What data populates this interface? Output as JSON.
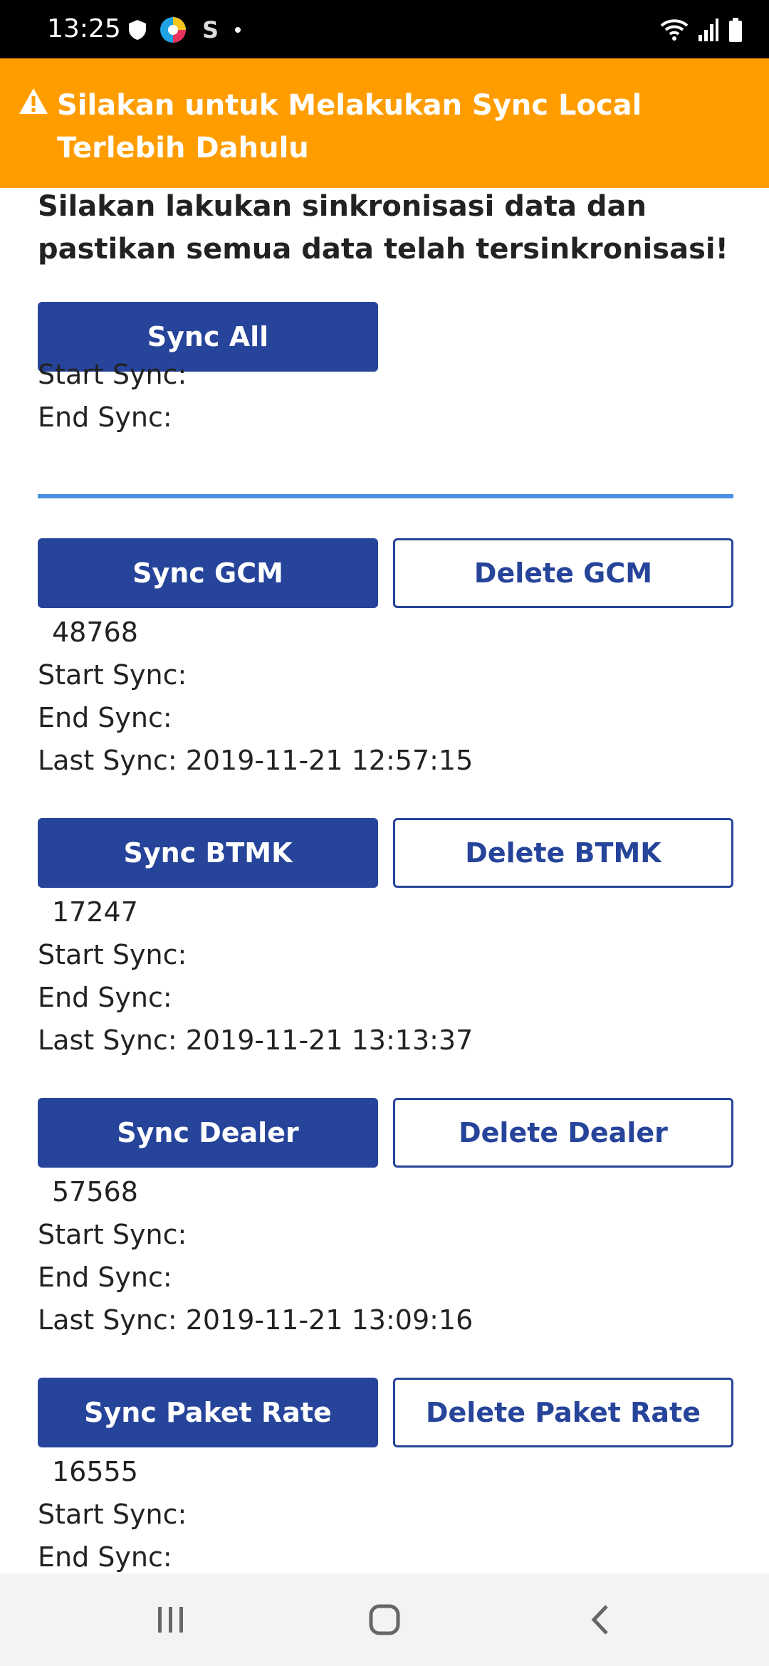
{
  "status_bar": {
    "time": "13:25",
    "left_icons": [
      "shield-icon",
      "colorful-app-icon",
      "s-app-icon",
      "dot-icon"
    ],
    "right_icons": [
      "wifi-icon",
      "signal-icon",
      "battery-icon"
    ]
  },
  "banner": {
    "icon": "warning-icon",
    "text": "Silakan untuk Melakukan Sync Local Terlebih Dahulu",
    "background": "#ff9d00"
  },
  "intro_text": "Silakan lakukan sinkronisasi data dan pastikan semua data telah tersinkronisasi!",
  "sync_all": {
    "label": "Sync All",
    "start_label": "Start Sync:",
    "end_label": "End Sync:"
  },
  "colors": {
    "primary": "#26449a",
    "divider": "#4a8fe2"
  },
  "sections": [
    {
      "sync_label": "Sync GCM",
      "delete_label": "Delete GCM",
      "count": "48768",
      "start_label": "Start Sync:",
      "end_label": "End Sync:",
      "last_sync": "Last Sync: 2019-11-21 12:57:15"
    },
    {
      "sync_label": "Sync BTMK",
      "delete_label": "Delete BTMK",
      "count": "17247",
      "start_label": "Start Sync:",
      "end_label": "End Sync:",
      "last_sync": "Last Sync: 2019-11-21 13:13:37"
    },
    {
      "sync_label": "Sync Dealer",
      "delete_label": "Delete Dealer",
      "count": "57568",
      "start_label": "Start Sync:",
      "end_label": "End Sync:",
      "last_sync": "Last Sync: 2019-11-21 13:09:16"
    },
    {
      "sync_label": "Sync Paket Rate",
      "delete_label": "Delete Paket Rate",
      "count": "16555",
      "start_label": "Start Sync:",
      "end_label": "End Sync:"
    }
  ],
  "nav_bar": {
    "icons": [
      "recent-apps-icon",
      "home-icon",
      "back-icon"
    ]
  }
}
